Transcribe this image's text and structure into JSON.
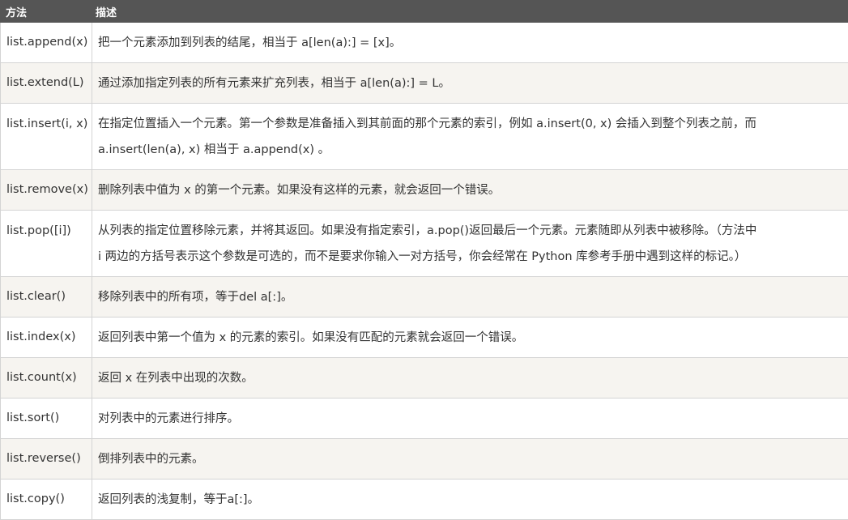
{
  "header": {
    "col_method": "方法",
    "col_desc": "描述"
  },
  "rows": [
    {
      "method": "list.append(x)",
      "desc": [
        "把一个元素添加到列表的结尾，相当于 a[len(a):] = [x]。"
      ]
    },
    {
      "method": "list.extend(L)",
      "desc": [
        "通过添加指定列表的所有元素来扩充列表，相当于 a[len(a):] = L。"
      ]
    },
    {
      "method": "list.insert(i, x)",
      "desc": [
        "在指定位置插入一个元素。第一个参数是准备插入到其前面的那个元素的索引，例如 a.insert(0, x) 会插入到整个列表之前，而",
        "a.insert(len(a), x) 相当于 a.append(x) 。"
      ]
    },
    {
      "method": "list.remove(x)",
      "desc": [
        "删除列表中值为 x 的第一个元素。如果没有这样的元素，就会返回一个错误。"
      ]
    },
    {
      "method": "list.pop([i])",
      "desc": [
        "从列表的指定位置移除元素，并将其返回。如果没有指定索引，a.pop()返回最后一个元素。元素随即从列表中被移除。（方法中",
        "i 两边的方括号表示这个参数是可选的，而不是要求你输入一对方括号，你会经常在 Python 库参考手册中遇到这样的标记。）"
      ]
    },
    {
      "method": "list.clear()",
      "desc": [
        "移除列表中的所有项，等于del a[:]。"
      ]
    },
    {
      "method": "list.index(x)",
      "desc": [
        "返回列表中第一个值为 x 的元素的索引。如果没有匹配的元素就会返回一个错误。"
      ]
    },
    {
      "method": "list.count(x)",
      "desc": [
        "返回 x 在列表中出现的次数。"
      ]
    },
    {
      "method": "list.sort()",
      "desc": [
        "对列表中的元素进行排序。"
      ]
    },
    {
      "method": "list.reverse()",
      "desc": [
        "倒排列表中的元素。"
      ]
    },
    {
      "method": "list.copy()",
      "desc": [
        "返回列表的浅复制，等于a[:]。"
      ]
    }
  ]
}
